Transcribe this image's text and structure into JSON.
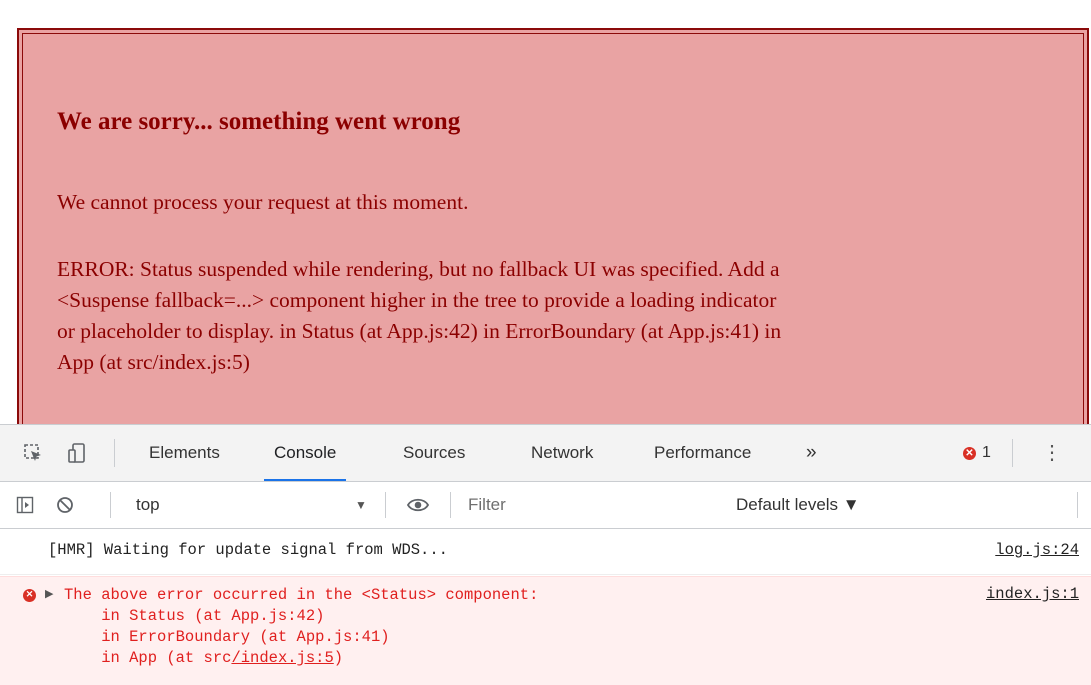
{
  "error_page": {
    "title": "We are sorry... something went wrong",
    "message": "We cannot process your request at this moment.",
    "detail_lines": [
      "ERROR: Status suspended while rendering, but no fallback UI was specified. Add a",
      "<Suspense fallback=...> component higher in the tree to provide a loading indicator",
      "or placeholder to display. in Status (at App.js:42) in ErrorBoundary (at App.js:41) in",
      "App (at src/index.js:5)"
    ],
    "colors": {
      "background": "#e9a3a3",
      "text": "#8b0000",
      "border": "#8b0a0a"
    }
  },
  "devtools": {
    "tabs": [
      "Elements",
      "Console",
      "Sources",
      "Network",
      "Performance"
    ],
    "active_tab": "Console",
    "more_tabs": "»",
    "error_count": "1",
    "menu": "⋮",
    "toolbar": {
      "context": "top",
      "filter_placeholder": "Filter",
      "levels": "Default levels ▼"
    },
    "console": {
      "info": {
        "text": "[HMR] Waiting for update signal from WDS...",
        "source": "log.js:24"
      },
      "error": {
        "line1": "The above error occurred in the <Status> component:",
        "line2": "    in Status (at App.js:42)",
        "line3": "    in ErrorBoundary (at App.js:41)",
        "line4_prefix": "    in App (at src",
        "line4_link": "/index.js:5",
        "line4_suffix": ")",
        "source": "index.js:1"
      }
    },
    "colors": {
      "accent": "#1a73e8",
      "error": "#d93025",
      "error_bg": "#fff0f0"
    }
  }
}
